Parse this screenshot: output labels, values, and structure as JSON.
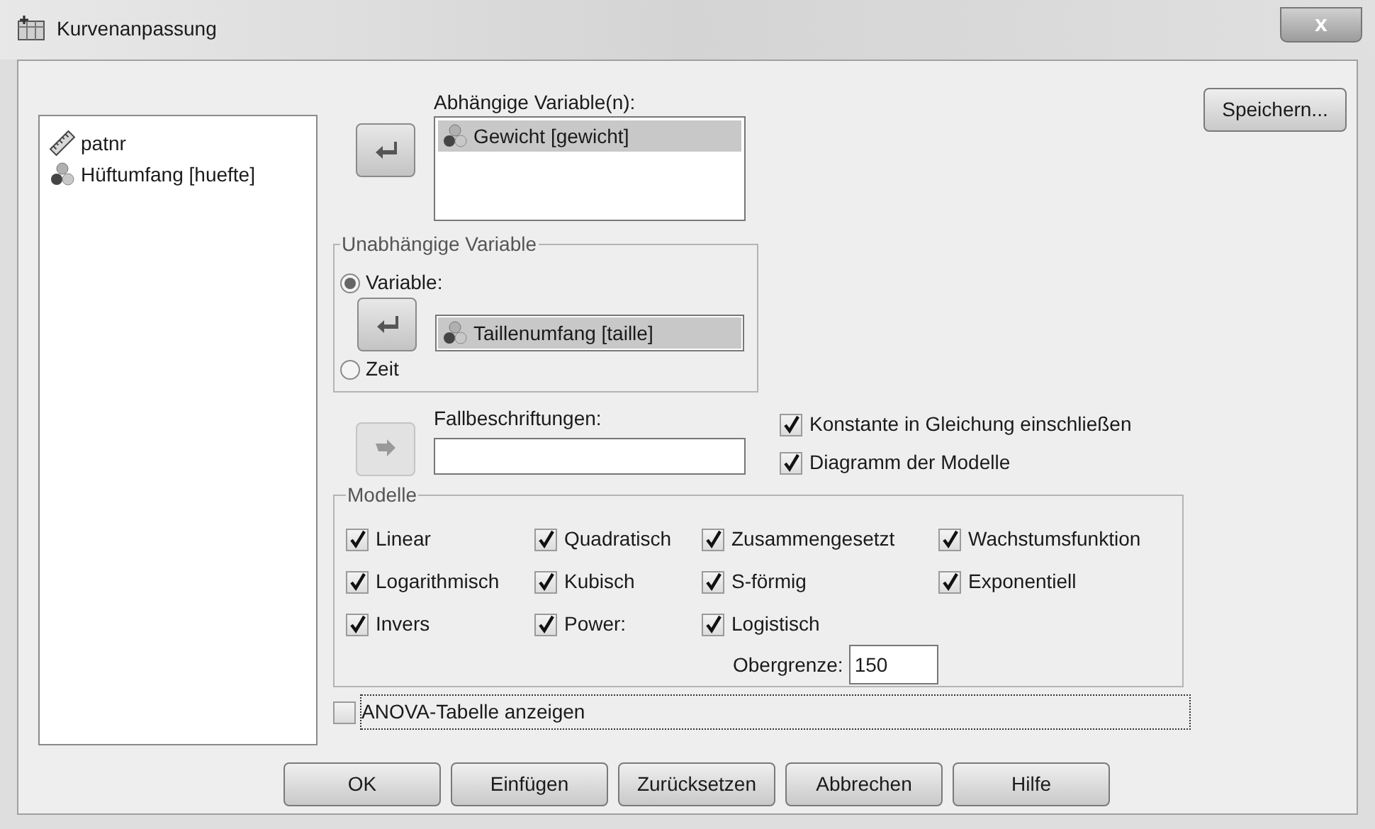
{
  "window": {
    "title": "Kurvenanpassung",
    "close": "x"
  },
  "source_list": [
    {
      "label": "patnr",
      "kind": "scale",
      "selected": false
    },
    {
      "label": "Hüftumfang [huefte]",
      "kind": "nominal",
      "selected": false
    }
  ],
  "dependent": {
    "label": "Abhängige Variable(n):",
    "arrow": {
      "kind": "left",
      "disabled": false
    },
    "items": [
      {
        "label": "Gewicht [gewicht]",
        "kind": "nominal",
        "selected": true
      }
    ]
  },
  "independent": {
    "title": "Unabhängige Variable",
    "options": [
      {
        "label": "Variable:",
        "selected": true
      },
      {
        "label": "Zeit",
        "selected": false
      }
    ],
    "arrow": {
      "kind": "left",
      "disabled": false
    },
    "value": {
      "label": "Taillenumfang [taille]",
      "kind": "nominal",
      "selected": true
    }
  },
  "case_labels": {
    "label": "Fallbeschriftungen:",
    "arrow": {
      "kind": "right",
      "disabled": true
    }
  },
  "options": [
    {
      "label": "Konstante in Gleichung einschließen",
      "checked": true
    },
    {
      "label": "Diagramm der Modelle",
      "checked": true
    }
  ],
  "models": {
    "title": "Modelle",
    "rows": [
      [
        {
          "label": "Linear",
          "checked": true
        },
        {
          "label": "Quadratisch",
          "checked": true
        },
        {
          "label": "Zusammengesetzt",
          "checked": true
        },
        {
          "label": "Wachstumsfunktion",
          "checked": true
        }
      ],
      [
        {
          "label": "Logarithmisch",
          "checked": true
        },
        {
          "label": "Kubisch",
          "checked": true
        },
        {
          "label": "S-förmig",
          "checked": true
        },
        {
          "label": "Exponentiell",
          "checked": true
        }
      ],
      [
        {
          "label": "Invers",
          "checked": true
        },
        {
          "label": "Power:",
          "checked": true
        },
        {
          "label": "Logistisch",
          "checked": true
        }
      ]
    ],
    "upper_bound": {
      "label": "Obergrenze:",
      "value": "150"
    }
  },
  "anova": {
    "label": "ANOVA-Tabelle anzeigen",
    "checked": false,
    "focused": true
  },
  "save_button": "Speichern...",
  "buttons": [
    "OK",
    "Einfügen",
    "Zurücksetzen",
    "Abbrechen",
    "Hilfe"
  ]
}
